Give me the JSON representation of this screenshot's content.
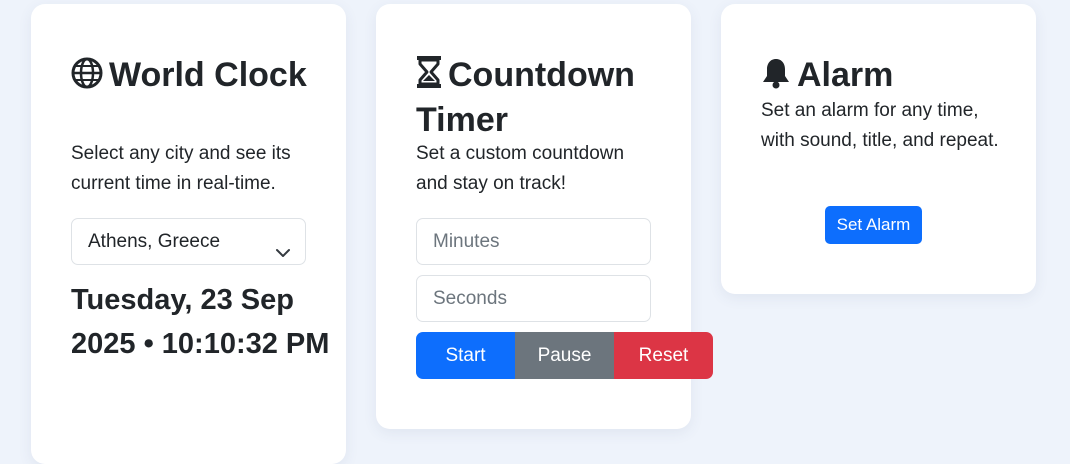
{
  "world_clock": {
    "title": "World Clock",
    "title_icon": "globe-icon",
    "description": "Select any city and see its current time in real-time.",
    "selected_city": "Athens, Greece",
    "current_time": "Tuesday, 23 Sep 2025 • 10:10:32 PM"
  },
  "countdown_timer": {
    "title": "Countdown Timer",
    "title_icon": "hourglass-icon",
    "description": "Set a custom countdown and stay on track!",
    "minutes_placeholder": "Minutes",
    "seconds_placeholder": "Seconds",
    "start_label": "Start",
    "pause_label": "Pause",
    "reset_label": "Reset"
  },
  "alarm": {
    "title": "Alarm",
    "title_icon": "bell-icon",
    "description": "Set an alarm for any time, with sound, title, and repeat.",
    "set_alarm_label": "Set Alarm"
  },
  "colors": {
    "background": "#eef3fb",
    "primary": "#0d6efd",
    "secondary": "#6c757d",
    "danger": "#dc3545"
  }
}
